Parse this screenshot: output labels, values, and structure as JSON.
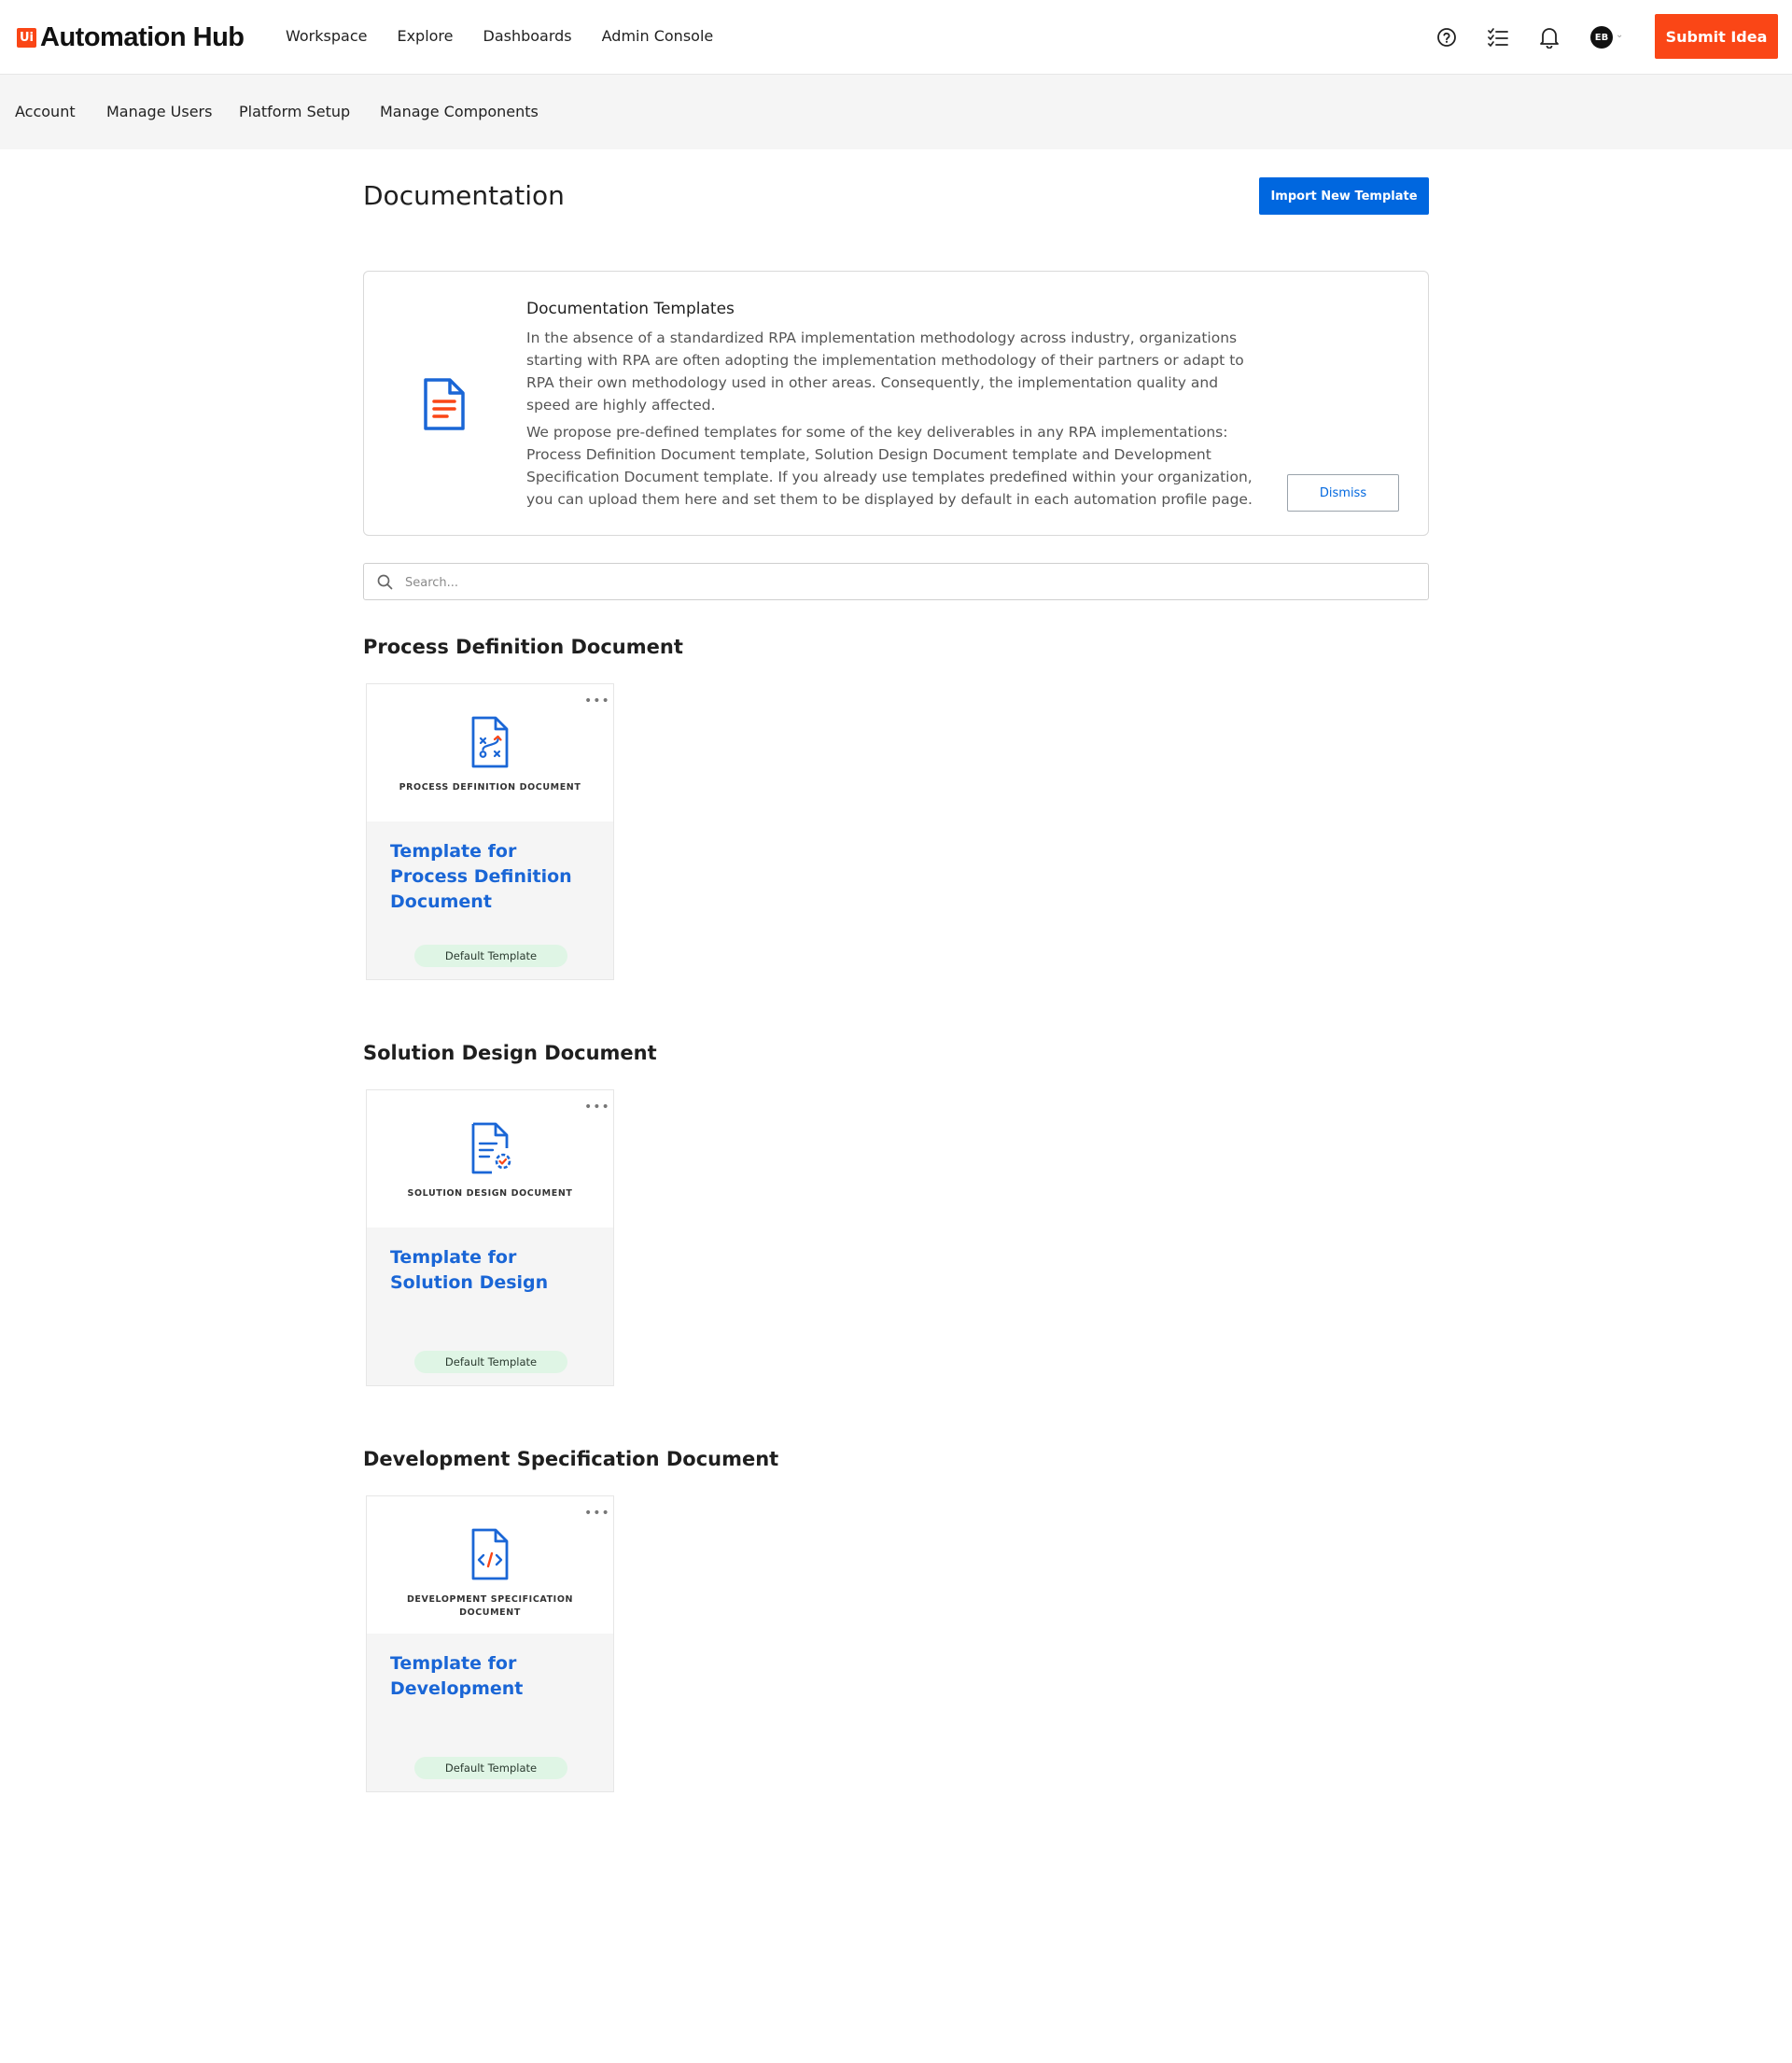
{
  "app": {
    "logo_mark": "Ui",
    "title": "Automation Hub",
    "brand_color": "#fa4616",
    "accent_color": "#0067df"
  },
  "top_nav": [
    "Workspace",
    "Explore",
    "Dashboards",
    "Admin Console"
  ],
  "header_icons": [
    "help-icon",
    "tasks-icon",
    "bell-icon"
  ],
  "user": {
    "initials": "EB"
  },
  "submit_idea_label": "Submit Idea",
  "sub_nav": [
    "Account",
    "Manage Users",
    "Platform Setup",
    "Manage Components"
  ],
  "page": {
    "title": "Documentation",
    "import_label": "Import New Template"
  },
  "info": {
    "title": "Documentation Templates",
    "p1": "In the absence of a standardized RPA implementation methodology across industry, organizations starting with RPA are often adopting the implementation methodology of their partners or adapt to RPA their own methodology used in other areas. Consequently, the implementation quality and speed are highly affected.",
    "p2": "We propose pre-defined templates for some of the key deliverables in any RPA implementations: Process Definition Document template, Solution Design Document template and Development Specification Document template. If you already use templates predefined within your organization, you can upload them here and set them to be displayed by default in each automation profile page.",
    "dismiss_label": "Dismiss"
  },
  "search": {
    "placeholder": "Search...",
    "value": ""
  },
  "sections": [
    {
      "title": "Process Definition Document",
      "card": {
        "caption": "PROCESS DEFINITION DOCUMENT",
        "title": "Template for Process Definition Document",
        "badge": "Default Template",
        "icon": "process-document-icon"
      }
    },
    {
      "title": "Solution Design Document",
      "card": {
        "caption": "SOLUTION DESIGN DOCUMENT",
        "title": "Template for Solution Design",
        "badge": "Default Template",
        "icon": "solution-design-document-icon"
      }
    },
    {
      "title": "Development Specification Document",
      "card": {
        "caption": "DEVELOPMENT SPECIFICATION DOCUMENT",
        "title": "Template for Development",
        "badge": "Default Template",
        "icon": "code-document-icon"
      }
    }
  ]
}
